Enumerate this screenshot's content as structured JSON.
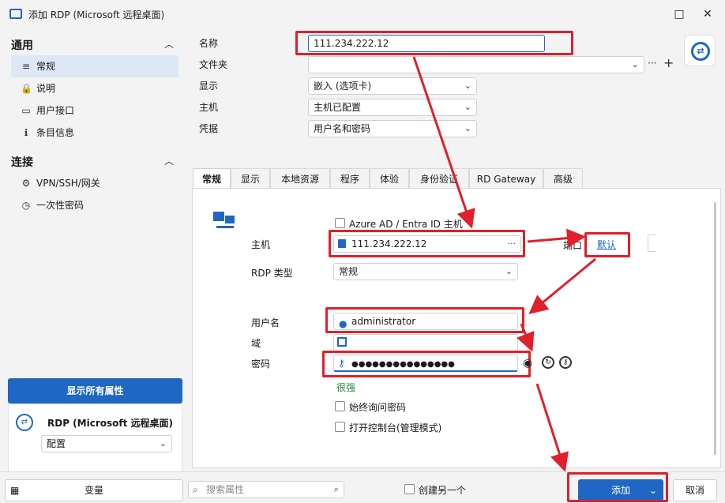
{
  "window": {
    "title": "添加 RDP (Microsoft 远程桌面)",
    "maximize_icon": "□",
    "close_icon": "✕"
  },
  "sidebar": {
    "general": {
      "label": "通用",
      "items": [
        {
          "icon": "≡",
          "label": "常规"
        },
        {
          "icon": "🔒",
          "label": "说明"
        },
        {
          "icon": "▭",
          "label": "用户接口"
        },
        {
          "icon": "ℹ",
          "label": "条目信息"
        }
      ]
    },
    "connection": {
      "label": "连接",
      "items": [
        {
          "icon": "⚙",
          "label": "VPN/SSH/网关"
        },
        {
          "icon": "◷",
          "label": "一次性密码"
        }
      ]
    },
    "show_all": "显示所有属性",
    "type_name": "RDP (Microsoft 远程桌面)",
    "config_select": "配置"
  },
  "form": {
    "name_label": "名称",
    "name_value": "111.234.222.12",
    "folder_label": "文件夹",
    "folder_value": "",
    "display_label": "显示",
    "display_value": "嵌入 (选项卡)",
    "host_label": "主机",
    "host_value": "主机已配置",
    "cred_label": "凭据",
    "cred_value": "用户名和密码"
  },
  "tabs": [
    "常规",
    "显示",
    "本地资源",
    "程序",
    "体验",
    "身份验证",
    "RD Gateway",
    "高级"
  ],
  "general_tab": {
    "azure_label": "Azure AD / Entra ID 主机",
    "host_label": "主机",
    "host_value": "111.234.222.12",
    "port_label": "端口",
    "port_value": "默认",
    "rdp_type_label": "RDP 类型",
    "rdp_type_value": "常规",
    "username_label": "用户名",
    "username_value": "administrator",
    "domain_label": "域",
    "domain_value": "",
    "password_label": "密码",
    "password_value": "●●●●●●●●●●●●●●●",
    "strength": "很强",
    "always_ask": "始终询问密码",
    "console": "打开控制台(管理模式)"
  },
  "bottom": {
    "variables": "变量",
    "search_placeholder": "搜索属性",
    "create_another": "创建另一个",
    "add": "添加",
    "cancel": "取消"
  },
  "colors": {
    "accent": "#1f67c2",
    "annotation": "#e0202a",
    "strength": "#1e8a3c"
  }
}
